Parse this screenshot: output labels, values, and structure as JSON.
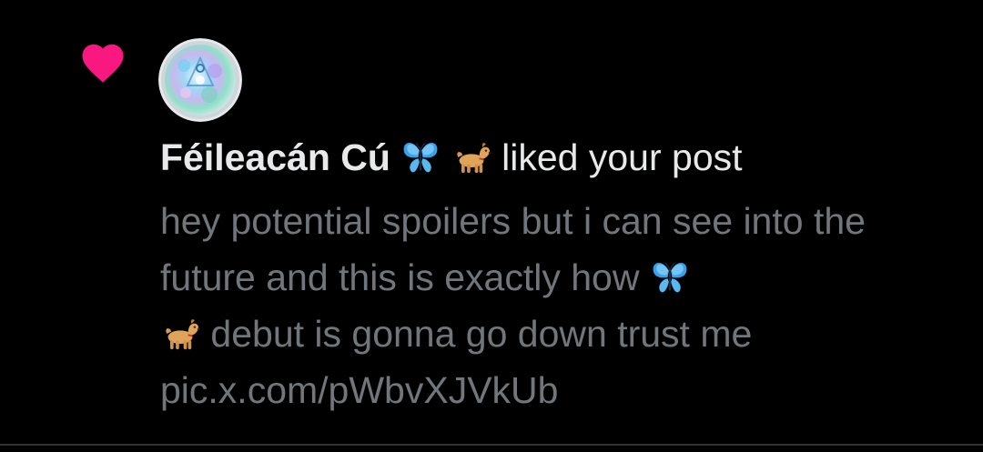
{
  "notification": {
    "type": "like",
    "user_name": "Féileacán Cú",
    "user_name_emojis": [
      "butterfly-emoji",
      "dog-emoji"
    ],
    "action_text": "liked your post",
    "post_text_part1": "hey potential spoilers but i can see into the future and this is exactly how",
    "post_text_part2": "debut is gonna go down trust me",
    "post_link": "pic.x.com/pWbvXJVkUb",
    "colors": {
      "background": "#000000",
      "heart": "#f91880",
      "primary_text": "#e7e9ea",
      "secondary_text": "#71767b",
      "divider": "#2f3336"
    }
  }
}
